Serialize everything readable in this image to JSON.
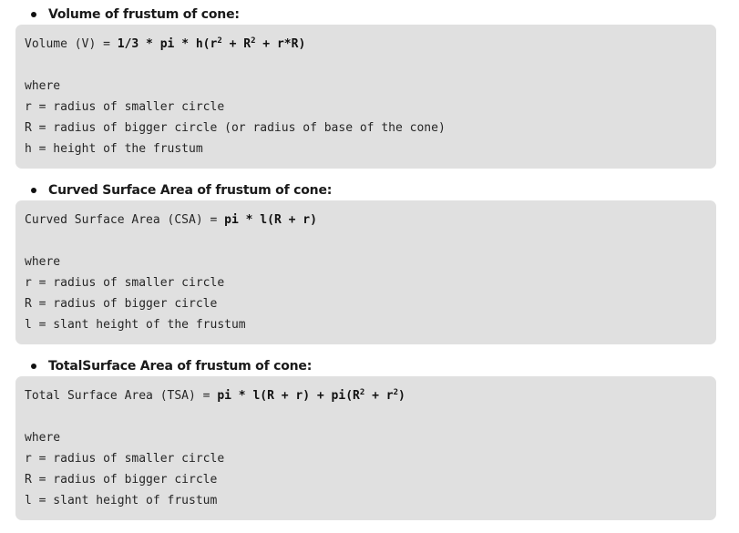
{
  "sections": [
    {
      "heading": "Volume of frustum of cone:",
      "formula": {
        "lhs": "Volume (V) = ",
        "rhs_parts": [
          "1/3 * pi * h(r",
          "2",
          " + R",
          "2",
          " + r*R)"
        ]
      },
      "where_label": "where",
      "definitions": [
        "r = radius of smaller circle",
        "R = radius of bigger circle (or radius of base of the cone)",
        "h = height of the frustum"
      ]
    },
    {
      "heading": "Curved Surface Area of frustum of cone:",
      "formula": {
        "lhs": "Curved Surface Area (CSA) = ",
        "rhs_parts": [
          "pi * l(R + r)"
        ]
      },
      "where_label": "where",
      "definitions": [
        "r = radius of smaller circle",
        "R = radius of bigger circle",
        "l = slant height of the frustum"
      ]
    },
    {
      "heading": "TotalSurface Area of frustum of cone:",
      "formula": {
        "lhs": "Total Surface Area (TSA) = ",
        "rhs_parts": [
          "pi * l(R + r) + pi(R",
          "2",
          " + r",
          "2",
          ")"
        ]
      },
      "where_label": "where",
      "definitions": [
        "r = radius of smaller circle",
        "R = radius of bigger circle",
        "l = slant height of frustum"
      ]
    }
  ]
}
